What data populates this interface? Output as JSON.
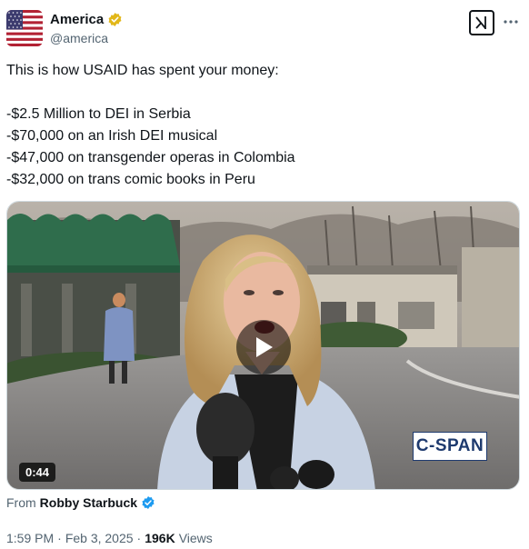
{
  "author": {
    "display_name": "America",
    "handle": "@america"
  },
  "tweet": {
    "lines": [
      "This is how USAID has spent your money:",
      "",
      "-$2.5 Million to DEI in Serbia",
      "-$70,000 on an Irish DEI musical",
      "-$47,000 on transgender operas in Colombia",
      "-$32,000 on trans comic books in Peru"
    ]
  },
  "media": {
    "duration": "0:44",
    "watermark": "C-SPAN"
  },
  "attribution": {
    "prefix": "From",
    "name": "Robby Starbuck"
  },
  "meta": {
    "time": "1:59 PM",
    "separator1": "·",
    "date": "Feb 3, 2025",
    "separator2": "·",
    "views_count": "196K",
    "views_label": "Views"
  },
  "colors": {
    "gold_badge": "#e2b719",
    "blue_badge": "#1d9bf0",
    "cspan_blue": "#1e3a6e"
  }
}
